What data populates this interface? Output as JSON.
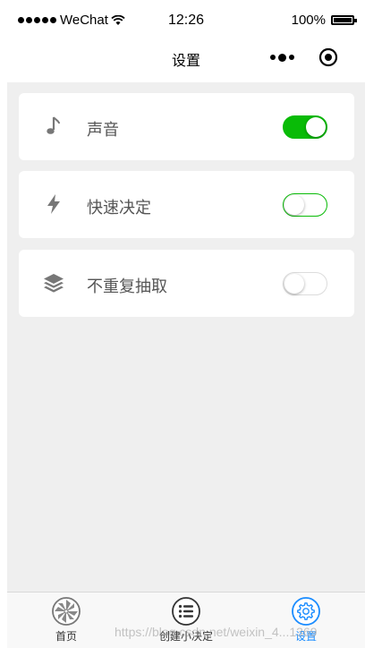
{
  "status_bar": {
    "carrier": "WeChat",
    "time": "12:26",
    "battery": "100%"
  },
  "nav": {
    "title": "设置",
    "more_icon": "more-dots-icon",
    "close_icon": "target-close-icon"
  },
  "settings": [
    {
      "label": "声音",
      "icon": "music-note-icon",
      "enabled": true
    },
    {
      "label": "快速决定",
      "icon": "lightning-icon",
      "enabled": false
    },
    {
      "label": "不重复抽取",
      "icon": "layers-icon",
      "enabled": false
    }
  ],
  "tabs": [
    {
      "label": "首页",
      "icon": "pinwheel-icon",
      "active": false
    },
    {
      "label": "创建小决定",
      "icon": "list-icon",
      "active": false
    },
    {
      "label": "设置",
      "icon": "gear-icon",
      "active": true
    }
  ],
  "watermark": "https://blog.csdn.net/weixin_4...1369",
  "colors": {
    "switch_on": "#09bb07",
    "tab_active": "#1a8cff",
    "background": "#efefef"
  }
}
